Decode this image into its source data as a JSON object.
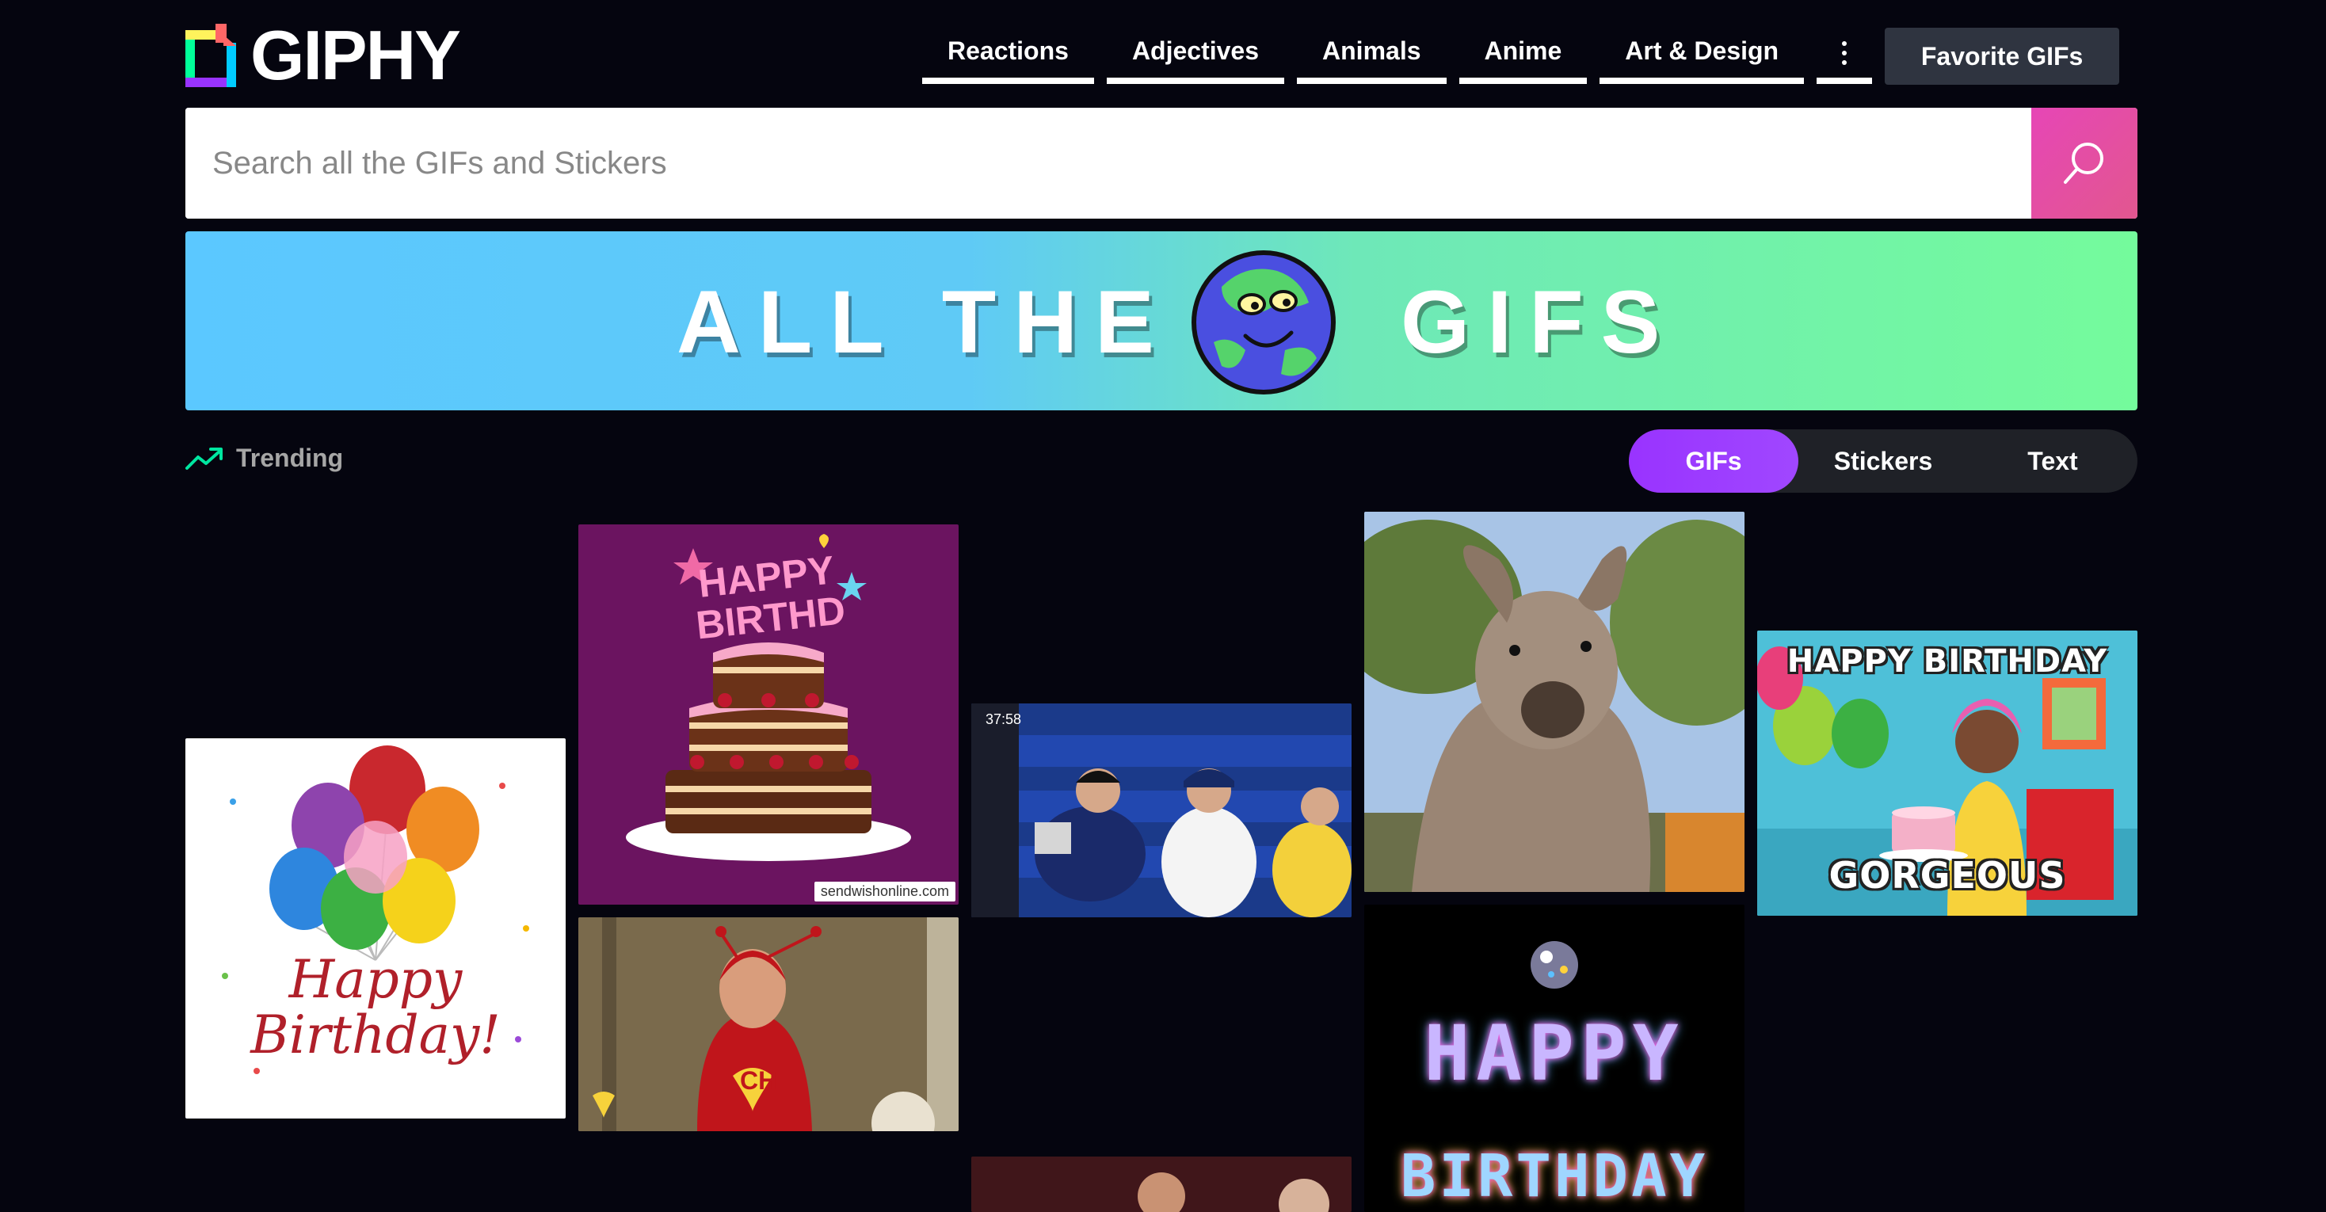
{
  "header": {
    "logo_text": "GIPHY",
    "nav": [
      "Reactions",
      "Adjectives",
      "Animals",
      "Anime",
      "Art & Design"
    ],
    "favorite_button": "Favorite GIFs"
  },
  "search": {
    "placeholder": "Search all the GIFs and Stickers"
  },
  "banner": {
    "left_text": "ALL THE",
    "right_text": "GIFS"
  },
  "trending": {
    "label": "Trending"
  },
  "tabs": {
    "items": [
      "GIFs",
      "Stickers",
      "Text"
    ],
    "active": "GIFs"
  },
  "gifs": {
    "birthday_balloons_text": "Happy Birthday!",
    "cake_title": "HAPPY BIRTHD",
    "cake_watermark": "sendwishonline.com",
    "sports_timer": "37:58",
    "gorgeous_top": "HAPPY BIRTHDAY",
    "gorgeous_bottom": "GORGEOUS",
    "chapulin_badge": "CH",
    "sparkle_line1": "HAPPY",
    "sparkle_line2": "BIRTHDAY"
  },
  "colors": {
    "background": "#05050f",
    "search_button": "#e646b6",
    "active_tab": "#9933ff",
    "banner_left": "#5bc8ff",
    "banner_right": "#74fb9c"
  }
}
